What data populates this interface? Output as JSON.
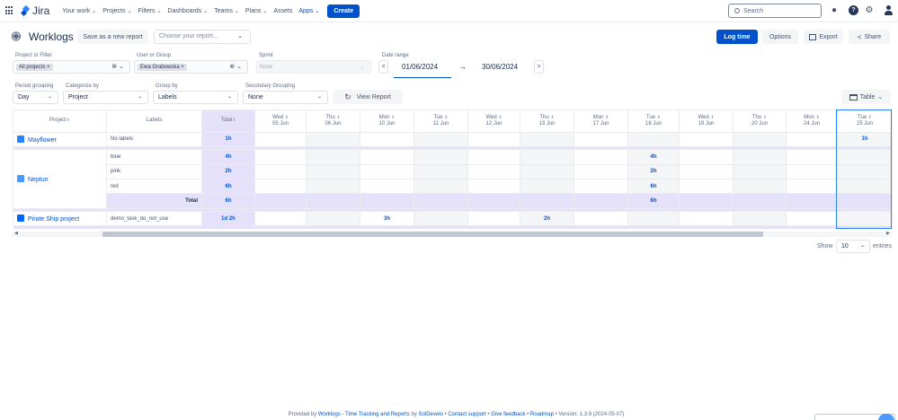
{
  "nav": {
    "logo": "Jira",
    "items": [
      {
        "label": "Your work",
        "chev": "⌄"
      },
      {
        "label": "Projects",
        "chev": "⌄"
      },
      {
        "label": "Filters",
        "chev": "⌄"
      },
      {
        "label": "Dashboards",
        "chev": "⌄"
      },
      {
        "label": "Teams",
        "chev": "⌄"
      },
      {
        "label": "Plans",
        "chev": "⌄"
      },
      {
        "label": "Assets",
        "chev": ""
      },
      {
        "label": "Apps",
        "chev": "⌄"
      }
    ],
    "create": "Create",
    "search_placeholder": "Search"
  },
  "header": {
    "title": "Worklogs",
    "save_report": "Save as a new report",
    "report_placeholder": "Choose your report...",
    "log_time": "Log time",
    "options": "Options",
    "export": "Export",
    "share": "Share"
  },
  "filters": {
    "project_label": "Project or Filter",
    "project_chip": "All projects ×",
    "user_label": "User or Group",
    "user_chip": "Ewa Grabowska ×",
    "sprint_label": "Sprint",
    "sprint_value": "None",
    "date_label": "Date range",
    "date_from": "01/06/2024",
    "date_arrow": "→",
    "date_to": "30/06/2024",
    "prev": "<",
    "next": ">",
    "clear": "⊗",
    "chev": "⌄",
    "period_label": "Period grouping",
    "period_value": "Day",
    "categorize_label": "Categorize by",
    "categorize_value": "Project",
    "group_label": "Group by",
    "group_value": "Labels",
    "secondary_label": "Secondary Grouping",
    "secondary_value": "None",
    "view_report": "View Report",
    "table_btn": "Table"
  },
  "table": {
    "col_project": "Project",
    "col_labels": "Labels",
    "col_total": "Total",
    "sort": "⬍",
    "days": [
      {
        "dow": "Wed",
        "date": "05 Jun"
      },
      {
        "dow": "Thu",
        "date": "06 Jun"
      },
      {
        "dow": "Mon",
        "date": "10 Jun"
      },
      {
        "dow": "Tue",
        "date": "11 Jun"
      },
      {
        "dow": "Wed",
        "date": "12 Jun"
      },
      {
        "dow": "Thu",
        "date": "13 Jun"
      },
      {
        "dow": "Mon",
        "date": "17 Jun"
      },
      {
        "dow": "Tue",
        "date": "18 Jun"
      },
      {
        "dow": "Wed",
        "date": "19 Jun"
      },
      {
        "dow": "Thu",
        "date": "20 Jun"
      },
      {
        "dow": "Mon",
        "date": "24 Jun"
      },
      {
        "dow": "Tue",
        "date": "25 Jun"
      }
    ],
    "mayflower": {
      "project": "Mayflower",
      "label": "No labels",
      "total": "1h",
      "d11": "1h",
      "icon_color": "#2684ff"
    },
    "neptun": {
      "project": "Neptun",
      "icon_color": "#4c9aff",
      "rows": [
        {
          "label": "blue",
          "total": "4h",
          "d7": "4h"
        },
        {
          "label": "pink",
          "total": "2h",
          "d7": "2h"
        },
        {
          "label": "red",
          "total": "6h",
          "d7": "6h"
        }
      ],
      "total_label": "Total",
      "total": "6h",
      "total_d7": "6h"
    },
    "pirate": {
      "project": "Pirate Ship project",
      "label": "demo_task_do_not_use",
      "total": "1d 2h",
      "d2": "3h",
      "d5": "2h",
      "icon_color": "#0065ff"
    }
  },
  "pagination": {
    "show": "Show",
    "value": "10",
    "chev": "⌄",
    "entries": "entries"
  },
  "footer": {
    "provided": "Provided by ",
    "plugin": "Worklogs - Time Tracking and Reports",
    "by": " by ",
    "vendor": "SolDevelo",
    "sep": " • ",
    "contact": "Contact support",
    "feedback": "Give feedback",
    "roadmap": "Roadmap",
    "version": "Version: 1.3.9 (2024-05-07)"
  }
}
